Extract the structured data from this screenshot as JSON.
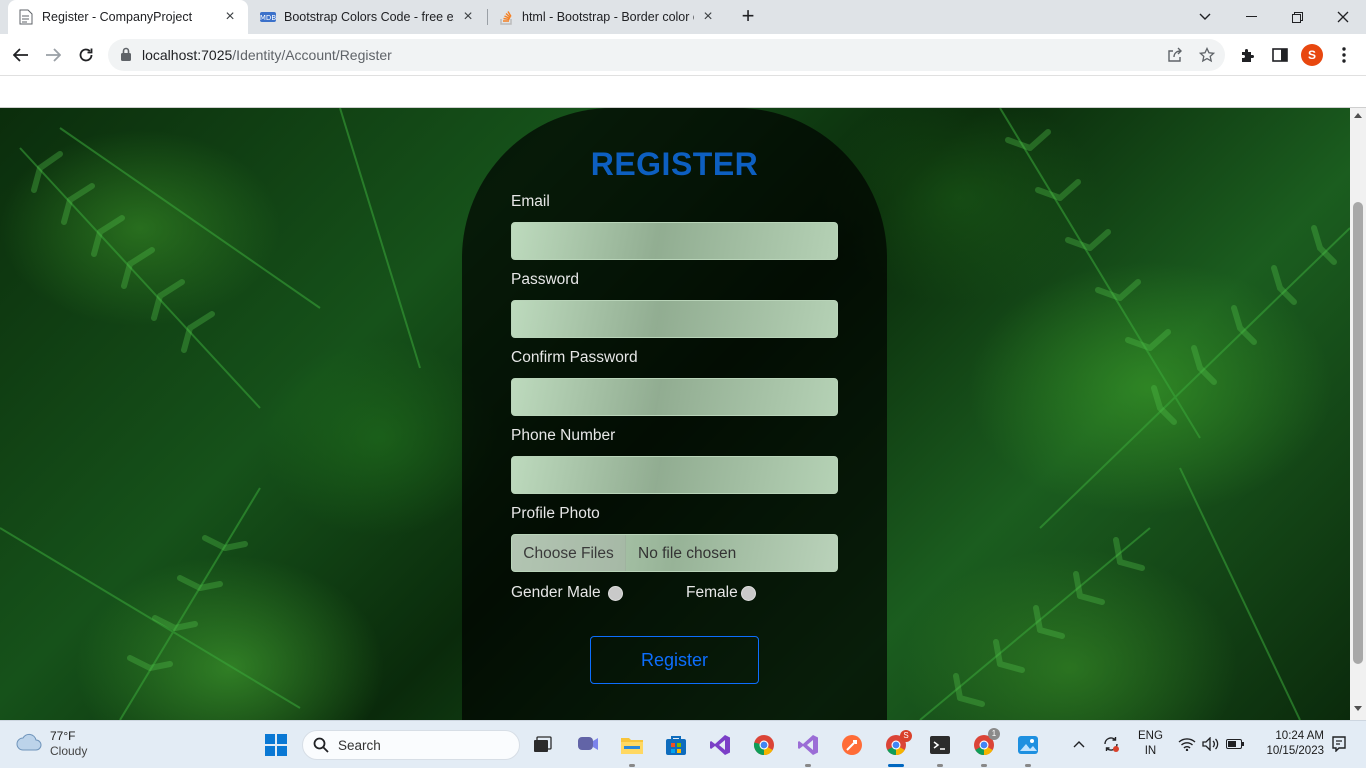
{
  "browser": {
    "tabs": [
      {
        "title": "Register - CompanyProject",
        "active": true,
        "favicon": "page-icon"
      },
      {
        "title": "Bootstrap Colors Code - free exa",
        "active": false,
        "favicon": "mdb-icon"
      },
      {
        "title": "html - Bootstrap - Border color c",
        "active": false,
        "favicon": "stackoverflow-icon"
      }
    ],
    "url_host": "localhost:7025",
    "url_path": "/Identity/Account/Register",
    "profile_initial": "S"
  },
  "form": {
    "title": "REGISTER",
    "fields": [
      {
        "label": "Email",
        "value": ""
      },
      {
        "label": "Password",
        "value": ""
      },
      {
        "label": "Confirm Password",
        "value": ""
      },
      {
        "label": "Phone Number",
        "value": ""
      }
    ],
    "photo_label": "Profile Photo",
    "file_button": "Choose Files",
    "file_status": "No file chosen",
    "gender_label": "Gender Male",
    "female_label": "Female",
    "submit": "Register"
  },
  "taskbar": {
    "weather_temp": "77°F",
    "weather_cond": "Cloudy",
    "search_placeholder": "Search",
    "lang_line1": "ENG",
    "lang_line2": "IN",
    "time": "10:24 AM",
    "date": "10/15/2023",
    "chrome_badge": "S",
    "chrome2_badge": "1"
  },
  "colors": {
    "title_blue": "#0d5fc1",
    "button_blue": "#0d6efd",
    "taskbar_bg": "#e3ecf5"
  }
}
